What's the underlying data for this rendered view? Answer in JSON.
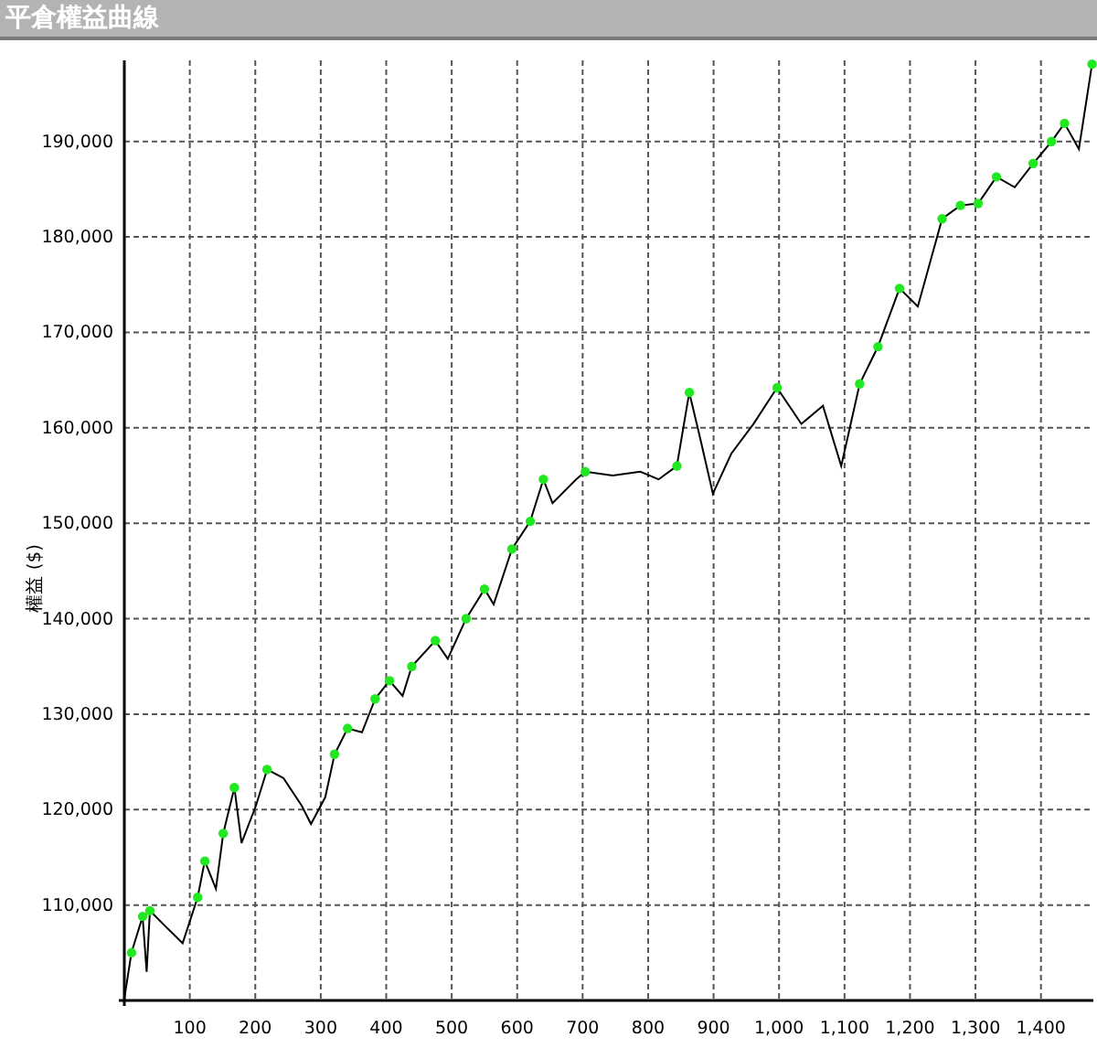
{
  "window": {
    "title": "平倉權益曲線"
  },
  "chart": {
    "chart_data": {
      "type": "line",
      "ylabel": "權益 ($)",
      "x": [
        0,
        11,
        28,
        34,
        39,
        61,
        89,
        112,
        123,
        140,
        151,
        168,
        179,
        201,
        218,
        243,
        271,
        285,
        307,
        321,
        341,
        363,
        383,
        405,
        425,
        439,
        475,
        494,
        522,
        550,
        564,
        592,
        620,
        640,
        654,
        690,
        704,
        746,
        788,
        816,
        844,
        863,
        880,
        899,
        927,
        961,
        997,
        1034,
        1067,
        1095,
        1123,
        1151,
        1184,
        1212,
        1249,
        1277,
        1304,
        1332,
        1360,
        1388,
        1416,
        1436,
        1458,
        1478
      ],
      "grid": true,
      "series": [
        {
          "color": "#000000",
          "values": [
            100200,
            105000,
            108800,
            103000,
            109400,
            107900,
            106000,
            110800,
            114600,
            111700,
            117500,
            122300,
            116500,
            120400,
            124200,
            123300,
            120400,
            118500,
            121300,
            125800,
            128500,
            128100,
            131600,
            133500,
            131900,
            135000,
            137700,
            135800,
            140000,
            143100,
            141500,
            147300,
            150200,
            154600,
            152100,
            154600,
            155400,
            155000,
            155400,
            154600,
            156000,
            163700,
            158800,
            153100,
            157300,
            160400,
            164200,
            160400,
            162300,
            156000,
            164600,
            168500,
            174600,
            172700,
            181900,
            183300,
            183500,
            186300,
            185200,
            187700,
            190000,
            191900,
            189200,
            198100
          ]
        }
      ],
      "xlim": [
        0,
        1480
      ],
      "ylim": [
        100000,
        198500
      ],
      "xticks": [
        {
          "value": 100,
          "label": "100"
        },
        {
          "value": 200,
          "label": "200"
        },
        {
          "value": 300,
          "label": "300"
        },
        {
          "value": 400,
          "label": "400"
        },
        {
          "value": 500,
          "label": "500"
        },
        {
          "value": 600,
          "label": "600"
        },
        {
          "value": 700,
          "label": "700"
        },
        {
          "value": 800,
          "label": "800"
        },
        {
          "value": 900,
          "label": "900"
        },
        {
          "value": 1000,
          "label": "1,000"
        },
        {
          "value": 1100,
          "label": "1,100"
        },
        {
          "value": 1200,
          "label": "1,200"
        },
        {
          "value": 1300,
          "label": "1,300"
        },
        {
          "value": 1400,
          "label": "1,400"
        }
      ],
      "yticks": [
        {
          "value": 110000,
          "label": "110,000"
        },
        {
          "value": 120000,
          "label": "120,000"
        },
        {
          "value": 130000,
          "label": "130,000"
        },
        {
          "value": 140000,
          "label": "140,000"
        },
        {
          "value": 150000,
          "label": "150,000"
        },
        {
          "value": 160000,
          "label": "160,000"
        },
        {
          "value": 170000,
          "label": "170,000"
        },
        {
          "value": 180000,
          "label": "180,000"
        },
        {
          "value": 190000,
          "label": "190,000"
        }
      ]
    }
  }
}
